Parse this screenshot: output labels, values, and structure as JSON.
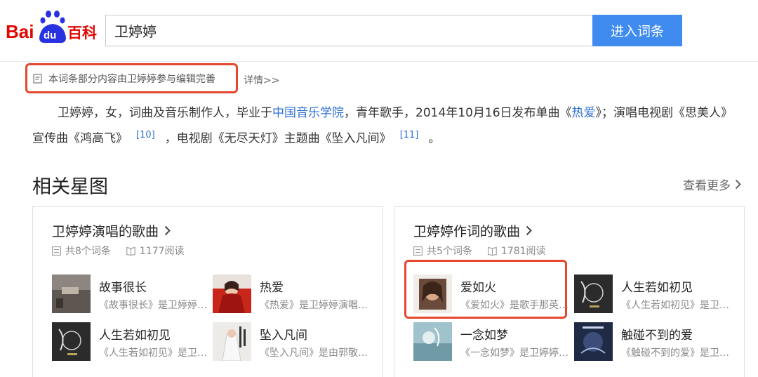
{
  "header": {
    "logo_text": "Bai du 百科",
    "search_value": "卫婷婷",
    "search_button": "进入词条"
  },
  "notice": {
    "text": "本词条部分内容由卫婷婷参与编辑完善",
    "details": "详情>>"
  },
  "summary": {
    "p1": "卫婷婷，女，词曲及音乐制作人，毕业于",
    "link1": "中国音乐学院",
    "p2": "，青年歌手，2014年10月16日发布单曲《",
    "link2": "热爱",
    "p3": "》；演唱电视剧《思美人》宣传曲《鸿高飞》",
    "ref1": "[10]",
    "p4": "，电视剧《无尽天灯》主题曲《坠入凡间》",
    "ref2": "[11]",
    "p5": "。"
  },
  "section": {
    "title": "相关星图",
    "see_more": "查看更多"
  },
  "cards": [
    {
      "title": "卫婷婷演唱的歌曲",
      "count": "共8个词条",
      "reads": "1177阅读",
      "songs": [
        {
          "title": "故事很长",
          "desc": "《故事很长》是卫婷婷演唱的歌曲"
        },
        {
          "title": "热爱",
          "desc": "《热爱》是卫婷婷演唱的歌曲"
        },
        {
          "title": "人生若如初见",
          "desc": "《人生若如初见》是卫婷婷演唱的歌曲"
        },
        {
          "title": "坠入凡间",
          "desc": "《坠入凡间》是由郭敬明作词的歌曲"
        }
      ]
    },
    {
      "title": "卫婷婷作词的歌曲",
      "count": "共5个词条",
      "reads": "1781阅读",
      "songs": [
        {
          "title": "爱如火",
          "desc": "《爱如火》是歌手那英演唱的歌曲"
        },
        {
          "title": "人生若如初见",
          "desc": "《人生若如初见》是卫婷婷演唱的歌曲"
        },
        {
          "title": "一念如梦",
          "desc": "《一念如梦》是卫婷婷演唱的歌曲"
        },
        {
          "title": "触碰不到的爱",
          "desc": "《触碰不到的爱》是卫婷婷演唱的歌曲"
        }
      ]
    }
  ],
  "colors": {
    "brand_red": "#e10602",
    "brand_blue": "#2932e1",
    "button_blue": "#3f8bf0",
    "link_blue": "#2f6fd6",
    "highlight_red": "#e5472f"
  }
}
